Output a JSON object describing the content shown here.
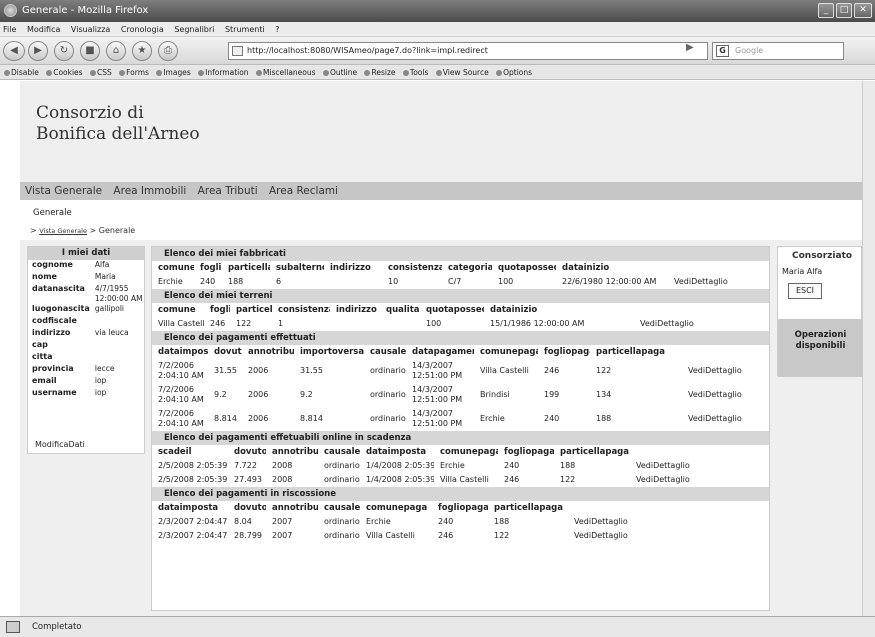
{
  "window": {
    "title": "Generale - Mozilla Firefox"
  },
  "menu": [
    "File",
    "Modifica",
    "Visualizza",
    "Cronologia",
    "Segnalibri",
    "Strumenti",
    "?"
  ],
  "nav": {
    "url": "http://localhost:8080/WISAmeo/page7.do?link=impl.redirect",
    "search_placeholder": "Google"
  },
  "devbar": [
    "Disable",
    "Cookies",
    "CSS",
    "Forms",
    "Images",
    "Information",
    "Miscellaneous",
    "Outline",
    "Resize",
    "Tools",
    "View Source",
    "Options"
  ],
  "site": {
    "logo_line1": "Consorzio di",
    "logo_line2": "Bonifica dell'Arneo",
    "tabs": [
      "Vista Generale",
      "Area Immobili",
      "Area Tributi",
      "Area Reclami"
    ],
    "page_label": "Generale",
    "breadcrumb_link": "Vista Generale",
    "breadcrumb_current": "Generale"
  },
  "miei_dati": {
    "title": "I miei dati",
    "rows": [
      {
        "k": "cognome",
        "v": "Alfa"
      },
      {
        "k": "nome",
        "v": "Maria"
      },
      {
        "k": "datanascita",
        "v": "4/7/1955 12:00:00 AM"
      },
      {
        "k": "luogonascita",
        "v": "gallipoli"
      },
      {
        "k": "codfiscale",
        "v": ""
      },
      {
        "k": "indirizzo",
        "v": "via leuca"
      },
      {
        "k": "cap",
        "v": ""
      },
      {
        "k": "citta",
        "v": ""
      },
      {
        "k": "provincia",
        "v": "lecce"
      },
      {
        "k": "email",
        "v": "iop"
      },
      {
        "k": "username",
        "v": "iop"
      }
    ],
    "edit_link": "ModificaDati"
  },
  "fabbricati": {
    "title": "Elenco dei miei fabbricati",
    "headers": [
      "comune",
      "foglio",
      "particella",
      "subalterno",
      "indirizzo",
      "consistenza",
      "categoria",
      "quotaposseduta",
      "datainizio",
      ""
    ],
    "rows": [
      [
        "Erchie",
        "240",
        "188",
        "6",
        "",
        "10",
        "C/7",
        "100",
        "22/6/1980 12:00:00 AM",
        "VediDettaglio"
      ]
    ]
  },
  "terreni": {
    "title": "Elenco dei miei terreni",
    "headers": [
      "comune",
      "foglio",
      "particella",
      "consistenza",
      "indirizzo",
      "qualita",
      "quotaposseduta",
      "datainizio",
      ""
    ],
    "rows": [
      [
        "Villa Castelli",
        "246",
        "122",
        "1",
        "",
        "",
        "100",
        "15/1/1986 12:00:00 AM",
        "VediDettaglio"
      ]
    ]
  },
  "pagamenti": {
    "title": "Elenco dei pagamenti effettuati",
    "headers": [
      "dataimposta",
      "dovuto",
      "annotributo",
      "importoversato",
      "causale",
      "datapagamento",
      "comunepaga",
      "fogliopaga",
      "particellapaga",
      ""
    ],
    "rows": [
      [
        "7/2/2006 2:04:10 AM",
        "31.55",
        "2006",
        "31.55",
        "ordinario",
        "14/3/2007 12:51:00 PM",
        "Villa Castelli",
        "246",
        "122",
        "VediDettaglio"
      ],
      [
        "7/2/2006 2:04:10 AM",
        "9.2",
        "2006",
        "9.2",
        "ordinario",
        "14/3/2007 12:51:00 PM",
        "Brindisi",
        "199",
        "134",
        "VediDettaglio"
      ],
      [
        "7/2/2006 2:04:10 AM",
        "8.814",
        "2006",
        "8.814",
        "ordinario",
        "14/3/2007 12:51:00 PM",
        "Erchie",
        "240",
        "188",
        "VediDettaglio"
      ]
    ]
  },
  "scadenza": {
    "title": "Elenco dei pagamenti effetuabili online in scadenza",
    "headers": [
      "scadeil",
      "dovuto",
      "annotributo",
      "causale",
      "dataimposta",
      "comunepaga",
      "fogliopaga",
      "particellapaga",
      ""
    ],
    "rows": [
      [
        "2/5/2008 2:05:39 AM",
        "7.722",
        "2008",
        "ordinario",
        "1/4/2008 2:05:39 AM",
        "Erchie",
        "240",
        "188",
        "VediDettaglio"
      ],
      [
        "2/5/2008 2:05:39 AM",
        "27.493",
        "2008",
        "ordinario",
        "1/4/2008 2:05:39 AM",
        "Villa Castelli",
        "246",
        "122",
        "VediDettaglio"
      ]
    ]
  },
  "riscossione": {
    "title": "Elenco dei pagamenti in riscossione",
    "headers": [
      "dataimposta",
      "dovuto",
      "annotributo",
      "causale",
      "comunepaga",
      "fogliopaga",
      "particellapaga",
      ""
    ],
    "rows": [
      [
        "2/3/2007 2:04:47 AM",
        "8.04",
        "2007",
        "ordinario",
        "Erchie",
        "240",
        "188",
        "VediDettaglio"
      ],
      [
        "2/3/2007 2:04:47 AM",
        "28.799",
        "2007",
        "ordinario",
        "Villa Castelli",
        "246",
        "122",
        "VediDettaglio"
      ]
    ]
  },
  "consorziato": {
    "title": "Consorziato",
    "user": "Maria Alfa",
    "exit_label": "ESCI",
    "ops_label": "Operazioni disponibili"
  },
  "status": {
    "text": "Completato"
  }
}
